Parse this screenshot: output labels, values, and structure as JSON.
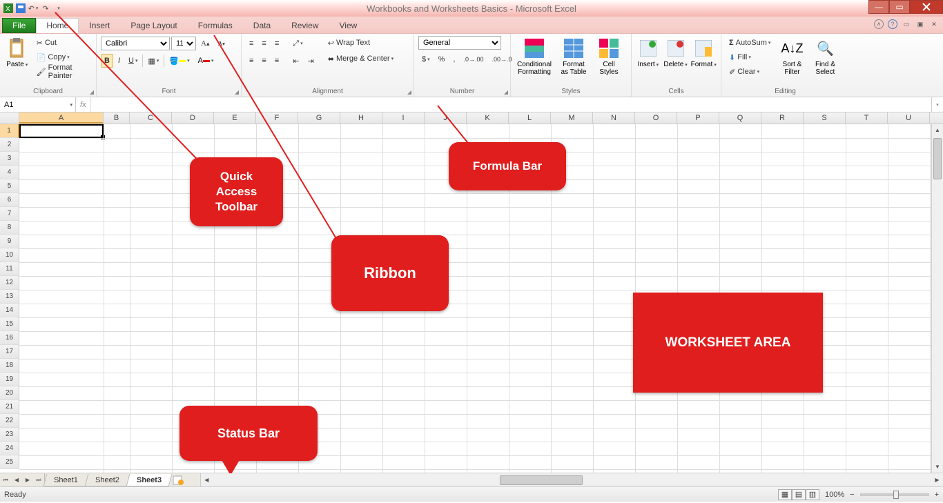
{
  "title": "Workbooks and Worksheets Basics - Microsoft Excel",
  "tabs": [
    "File",
    "Home",
    "Insert",
    "Page Layout",
    "Formulas",
    "Data",
    "Review",
    "View"
  ],
  "activeTab": "Home",
  "ribbon": {
    "clipboard": {
      "paste": "Paste",
      "cut": "Cut",
      "copy": "Copy",
      "fp": "Format Painter",
      "label": "Clipboard"
    },
    "font": {
      "name": "Calibri",
      "size": "11",
      "label": "Font"
    },
    "alignment": {
      "wrap": "Wrap Text",
      "merge": "Merge & Center",
      "label": "Alignment"
    },
    "number": {
      "format": "General",
      "label": "Number"
    },
    "styles": {
      "cond": "Conditional\nFormatting",
      "fat": "Format\nas Table",
      "cell": "Cell\nStyles",
      "label": "Styles"
    },
    "cells": {
      "ins": "Insert",
      "del": "Delete",
      "fmt": "Format",
      "label": "Cells"
    },
    "editing": {
      "autosum": "AutoSum",
      "fill": "Fill",
      "clear": "Clear",
      "sort": "Sort &\nFilter",
      "find": "Find &\nSelect",
      "label": "Editing"
    }
  },
  "nameBox": "A1",
  "columns": [
    "A",
    "B",
    "C",
    "D",
    "E",
    "F",
    "G",
    "H",
    "I",
    "J",
    "K",
    "L",
    "M",
    "N",
    "O",
    "P",
    "Q",
    "R",
    "S",
    "T",
    "U"
  ],
  "rows": 25,
  "sheets": [
    "Sheet1",
    "Sheet2",
    "Sheet3"
  ],
  "activeSheet": "Sheet3",
  "status": "Ready",
  "zoom": "100%",
  "callouts": {
    "qat": "Quick Access Toolbar",
    "ribbon": "Ribbon",
    "formula": "Formula Bar",
    "status": "Status Bar",
    "worksheet": "WORKSHEET AREA"
  }
}
